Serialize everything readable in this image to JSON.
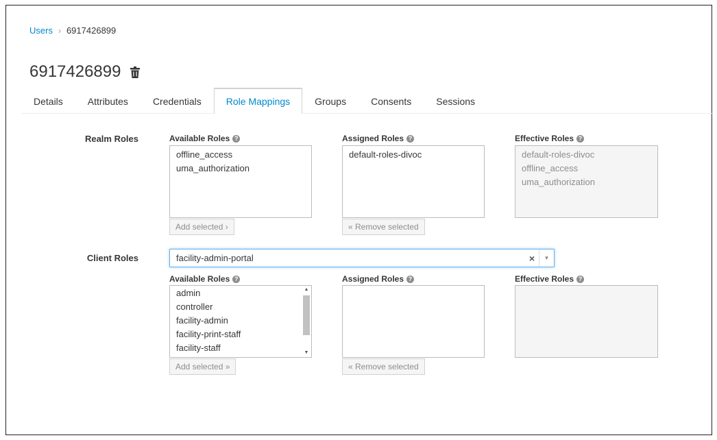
{
  "breadcrumb": {
    "parent": "Users",
    "separator": "›",
    "current": "6917426899"
  },
  "page": {
    "title": "6917426899"
  },
  "tabs": [
    {
      "label": "Details"
    },
    {
      "label": "Attributes"
    },
    {
      "label": "Credentials"
    },
    {
      "label": "Role Mappings",
      "active": true
    },
    {
      "label": "Groups"
    },
    {
      "label": "Consents"
    },
    {
      "label": "Sessions"
    }
  ],
  "realm_roles": {
    "label": "Realm Roles",
    "available": {
      "header": "Available Roles",
      "items": [
        "offline_access",
        "uma_authorization"
      ],
      "button": "Add selected ›"
    },
    "assigned": {
      "header": "Assigned Roles",
      "items": [
        "default-roles-divoc"
      ],
      "button": "« Remove selected"
    },
    "effective": {
      "header": "Effective Roles",
      "items": [
        "default-roles-divoc",
        "offline_access",
        "uma_authorization"
      ]
    }
  },
  "client_roles": {
    "label": "Client Roles",
    "client_select": {
      "value": "facility-admin-portal",
      "clear": "×",
      "arrow": "▼"
    },
    "available": {
      "header": "Available Roles",
      "items": [
        "admin",
        "controller",
        "facility-admin",
        "facility-print-staff",
        "facility-staff"
      ],
      "button": "Add selected »"
    },
    "assigned": {
      "header": "Assigned Roles",
      "items": [],
      "button": "« Remove selected"
    },
    "effective": {
      "header": "Effective Roles",
      "items": []
    }
  },
  "icons": {
    "help": "question-circle-icon",
    "trash": "trash-icon"
  },
  "colors": {
    "link": "#0088ce",
    "text": "#363636",
    "muted": "#8b8d8f",
    "focus": "#66afe9"
  }
}
